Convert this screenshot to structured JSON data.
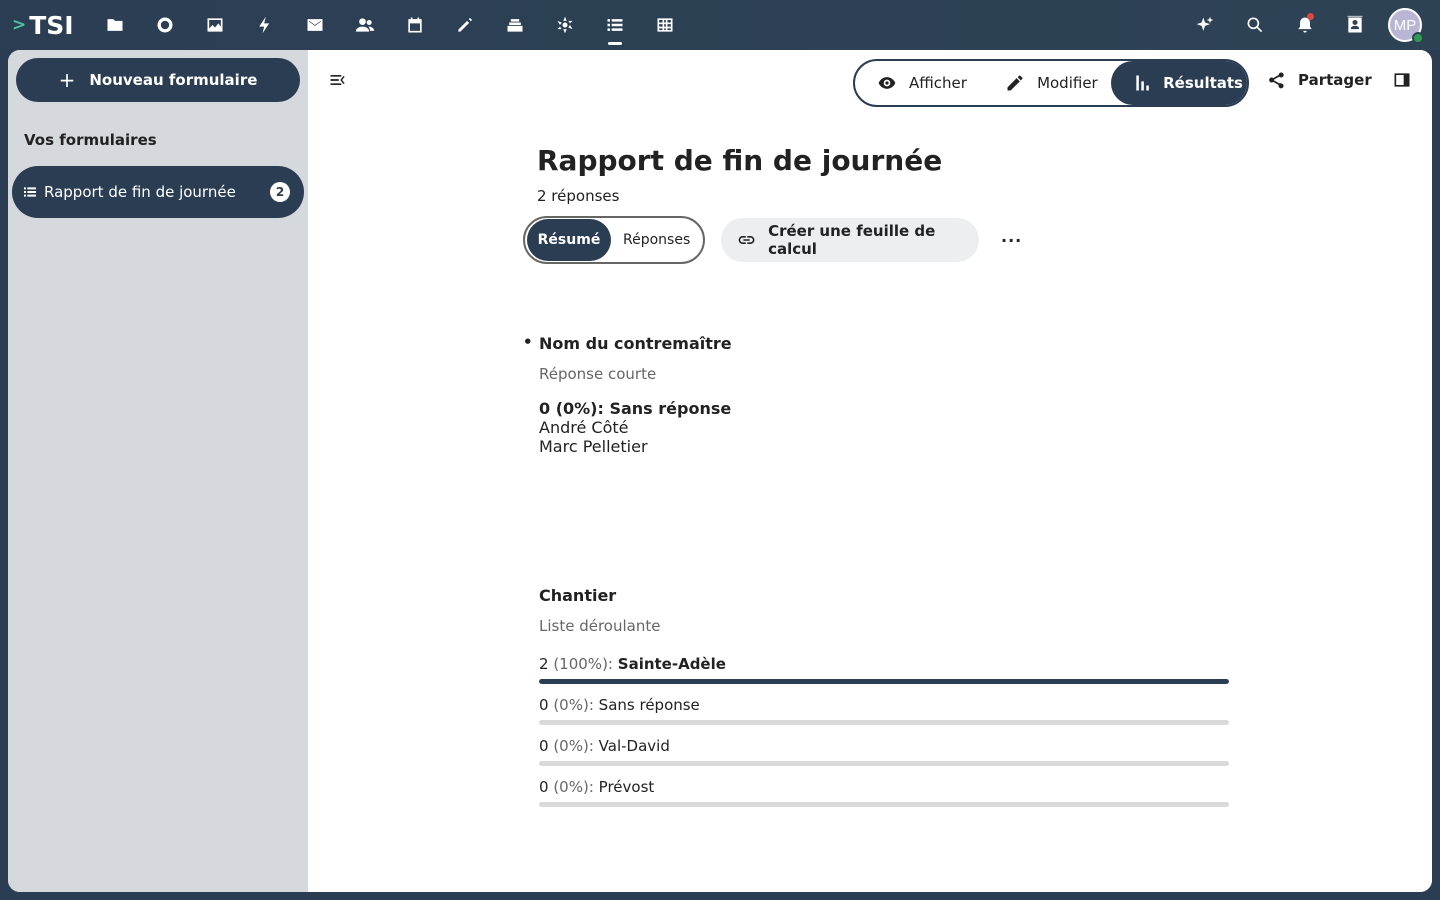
{
  "brand": {
    "logo_text": "TSI",
    "logo_chevron": ">"
  },
  "topbar": {
    "apps": [
      "files-icon",
      "circle-icon",
      "photos-icon",
      "activity-icon",
      "mail-icon",
      "contacts-icon",
      "calendar-icon",
      "notes-icon",
      "deck-icon",
      "integration-icon",
      "forms-icon",
      "tables-icon"
    ],
    "active_app": "forms-icon",
    "avatar_initials": "MP"
  },
  "sidebar": {
    "new_form_label": "Nouveau formulaire",
    "section_title": "Vos formulaires",
    "forms": [
      {
        "label": "Rapport de fin de journée",
        "count": "2"
      }
    ]
  },
  "header": {
    "view_afficher": "Afficher",
    "view_modifier": "Modifier",
    "view_resultats": "Résultats",
    "share_label": "Partager"
  },
  "form": {
    "title": "Rapport de fin de journée",
    "response_count": "2 réponses",
    "tab_resume": "Résumé",
    "tab_reponses": "Réponses",
    "sheet_button": "Créer une feuille de calcul",
    "more_button": "···"
  },
  "questions": [
    {
      "title": "Nom du contremaître",
      "type": "Réponse courte",
      "answers": [
        "0 (0%): Sans réponse",
        "André Côté",
        "Marc Pelletier"
      ]
    },
    {
      "title": "Chantier",
      "type": "Liste déroulante",
      "options": [
        {
          "count": "2",
          "pct": "(100%):",
          "name": "Sainte-Adèle",
          "fraction": 1.0
        },
        {
          "count": "0",
          "pct": "(0%):",
          "name": "Sans réponse",
          "fraction": 0.0
        },
        {
          "count": "0",
          "pct": "(0%):",
          "name": "Val-David",
          "fraction": 0.0
        },
        {
          "count": "0",
          "pct": "(0%):",
          "name": "Prévost",
          "fraction": 0.0
        }
      ]
    }
  ],
  "colors": {
    "accent": "#2b3d52",
    "topbar": "#2e4256",
    "sidebar": "#d5d8dc"
  }
}
